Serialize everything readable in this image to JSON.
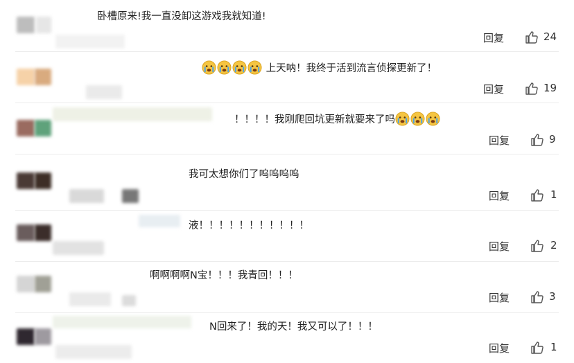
{
  "comments": [
    {
      "text": "卧槽原来!我一直没卸这游戏我就知道!",
      "reply": "回复",
      "likes": "24"
    },
    {
      "text": "上天呐！我终于活到流言侦探更新了！",
      "emoji_prefix_count": 4,
      "reply": "回复",
      "likes": "19"
    },
    {
      "text": "！！！！我刚爬回坑更新就要来了吗",
      "emoji_suffix_count": 3,
      "reply": "回复",
      "likes": "9"
    },
    {
      "text": "我可太想你们了呜呜呜呜",
      "reply": "回复",
      "likes": "1"
    },
    {
      "text": "液！！！！！！！！！！！",
      "reply": "回复",
      "likes": "2"
    },
    {
      "text": "啊啊啊啊N宝！！！我青回！！！",
      "reply": "回复",
      "likes": "3"
    },
    {
      "text": "N回来了！我的天！我又可以了！！！",
      "reply": "回复",
      "likes": "1"
    }
  ],
  "icons": {
    "like": "thumbs-up-icon",
    "emoji": "crying-face-emoji"
  },
  "colors": {
    "emoji_face": "#f5c542",
    "emoji_tear": "#4aa3e8",
    "divider": "#ececec"
  }
}
